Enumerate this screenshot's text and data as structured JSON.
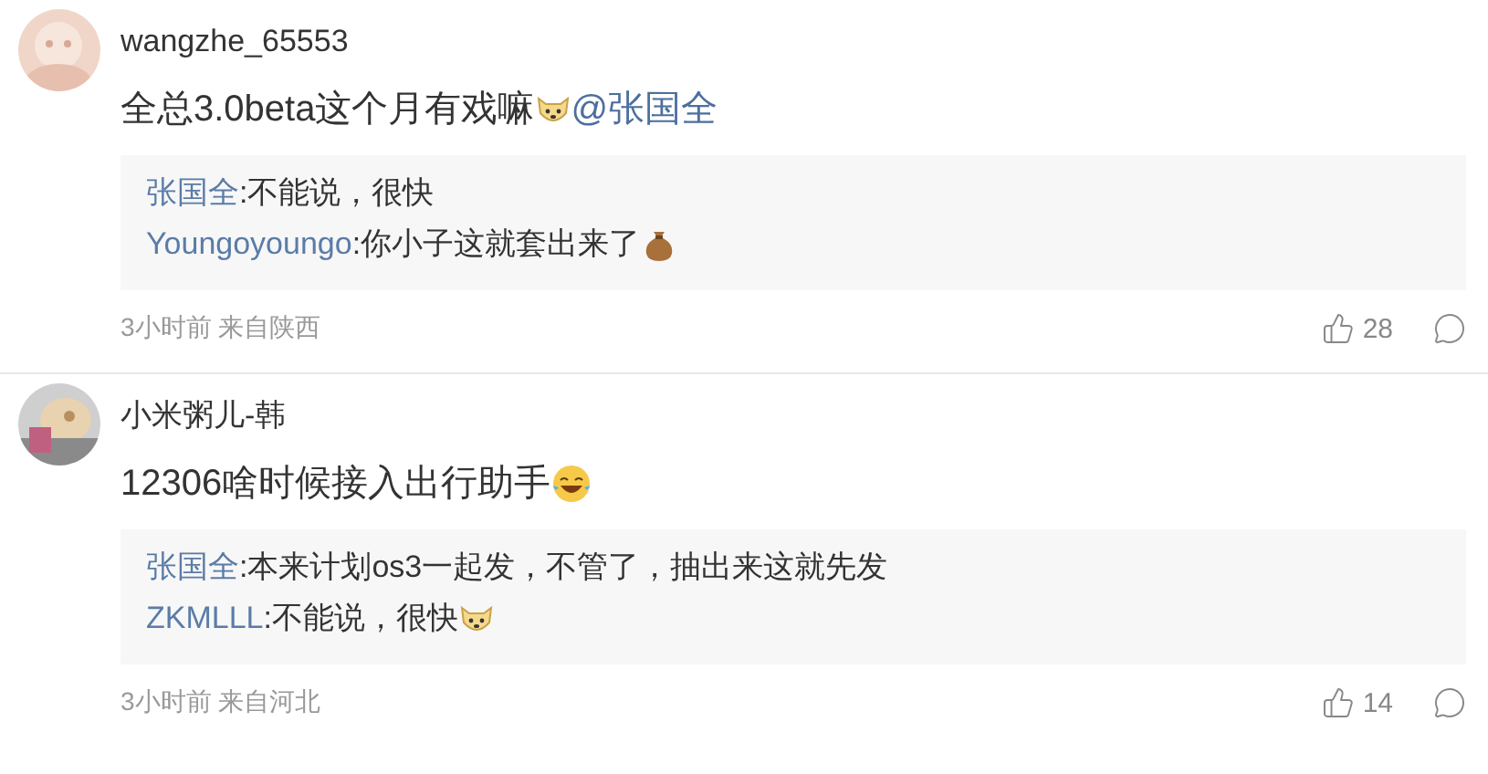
{
  "comments": [
    {
      "username": "wangzhe_65553",
      "content": [
        {
          "kind": "text",
          "text": "全总3.0beta这个月有戏嘛"
        },
        {
          "kind": "dog"
        },
        {
          "kind": "mention",
          "text": "@张国全"
        }
      ],
      "replies": [
        {
          "author": "张国全",
          "parts": [
            {
              "kind": "text",
              "text": ":不能说，很快"
            }
          ]
        },
        {
          "author": "Youngoyoungo",
          "parts": [
            {
              "kind": "text",
              "text": ":你小子这就套出来了"
            },
            {
              "kind": "pouch"
            }
          ]
        }
      ],
      "meta": "3小时前 来自陕西",
      "likes": "28"
    },
    {
      "username": "小米粥儿-韩",
      "content": [
        {
          "kind": "text",
          "text": "12306啥时候接入出行助手"
        },
        {
          "kind": "laugh"
        }
      ],
      "replies": [
        {
          "author": "张国全",
          "parts": [
            {
              "kind": "text",
              "text": ":本来计划os3一起发，不管了，抽出来这就先发"
            }
          ]
        },
        {
          "author": "ZKMLLL",
          "parts": [
            {
              "kind": "text",
              "text": ":不能说，很快"
            },
            {
              "kind": "dog"
            }
          ]
        }
      ],
      "meta": "3小时前 来自河北",
      "likes": "14"
    }
  ]
}
